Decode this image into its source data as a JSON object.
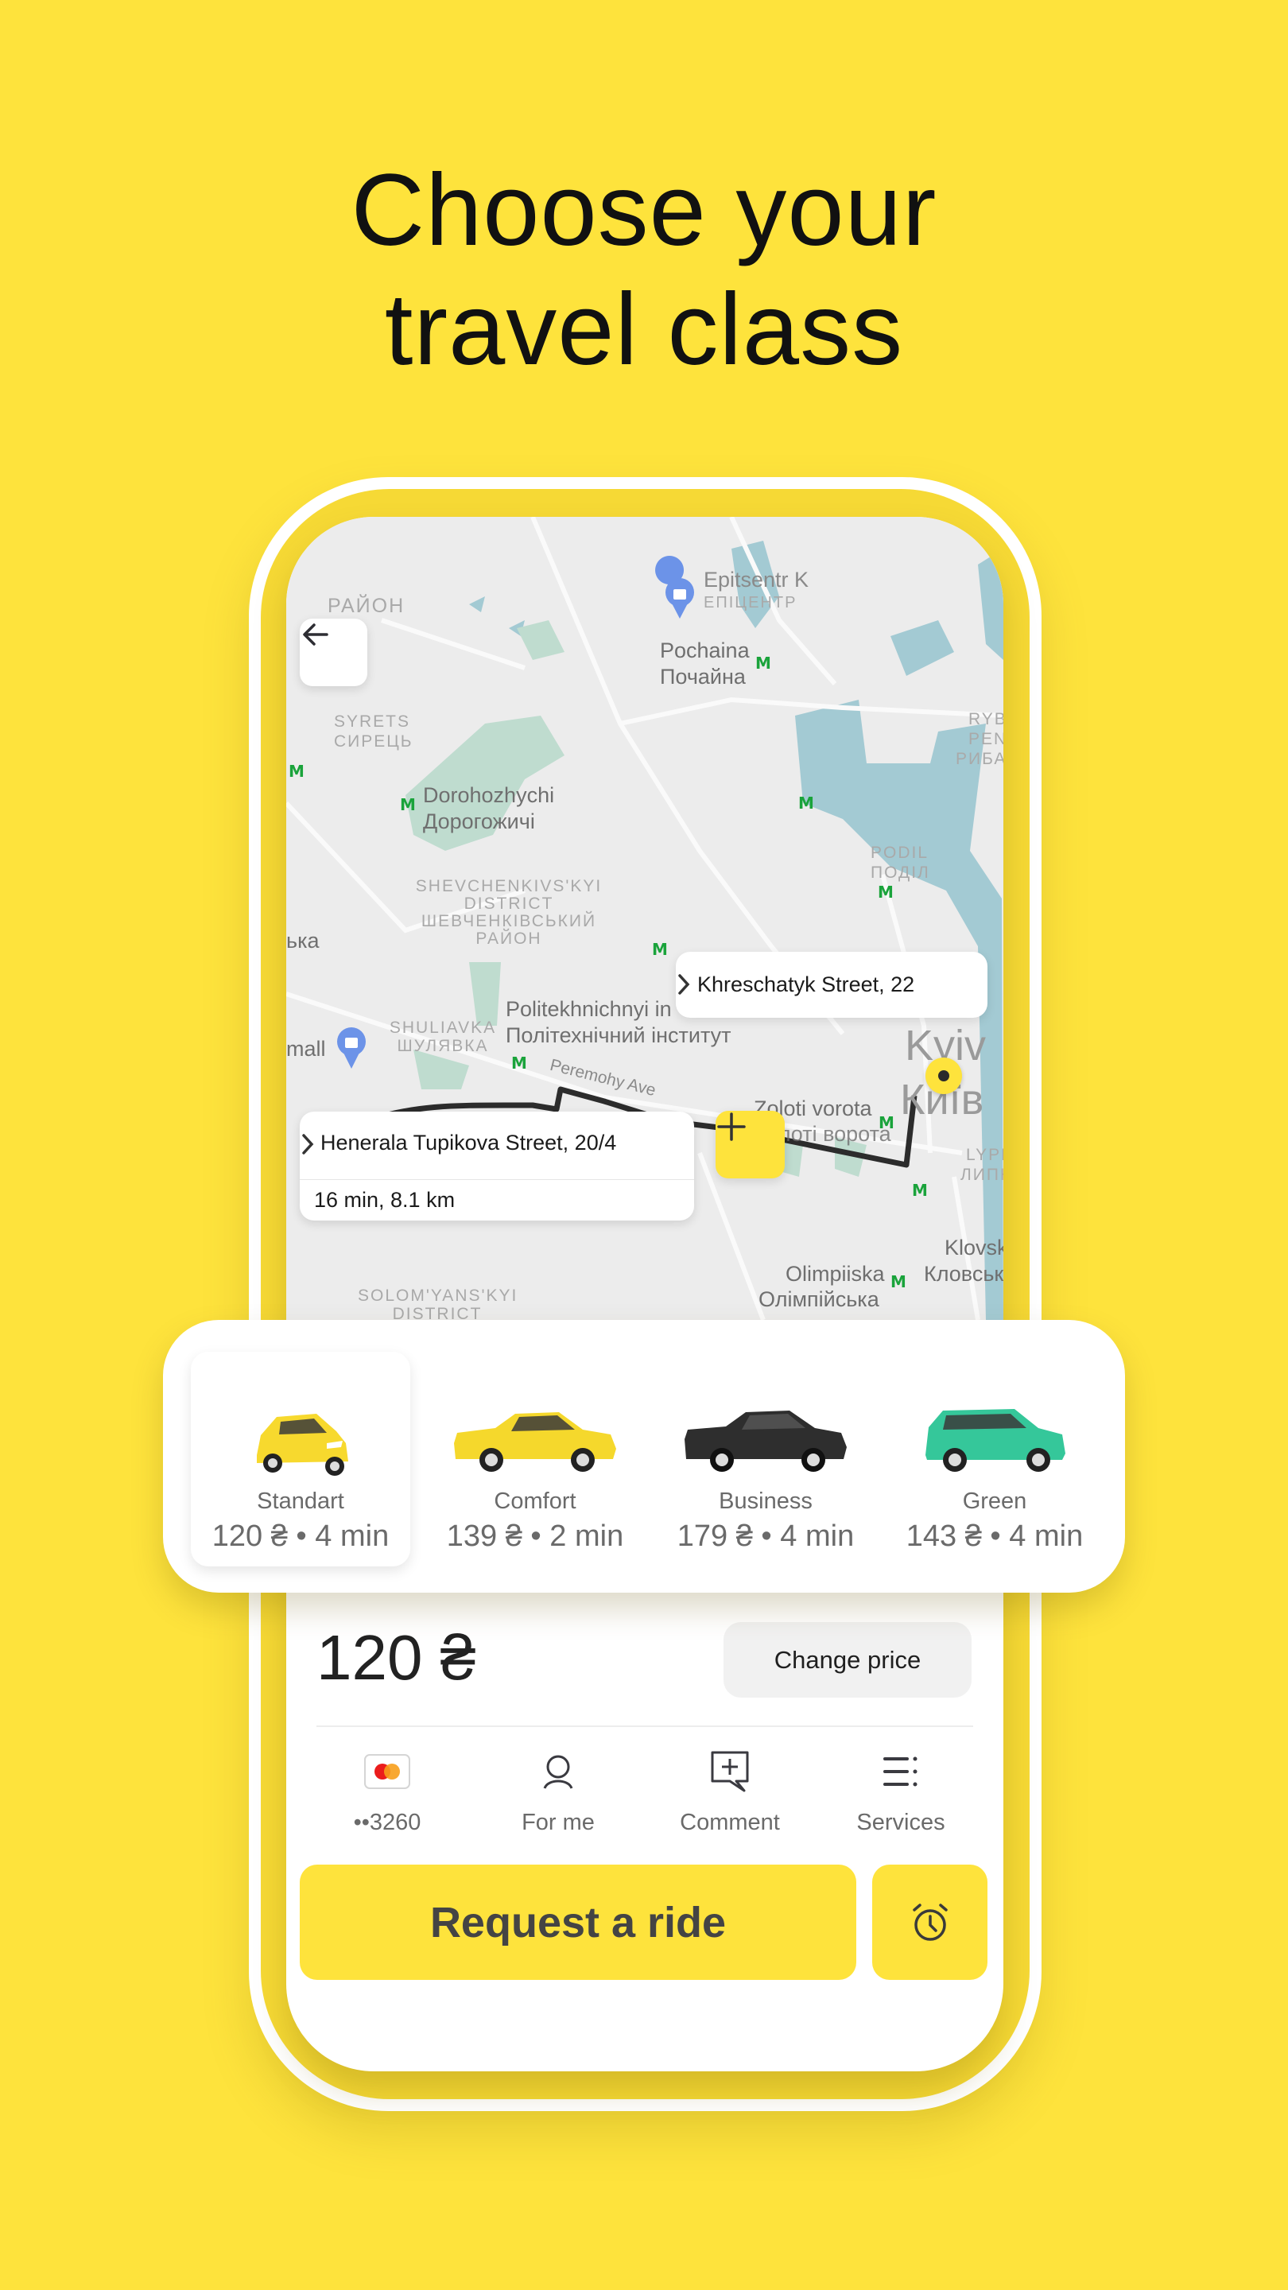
{
  "headline": {
    "line1": "Choose your",
    "line2": "travel class"
  },
  "map": {
    "labels": {
      "raion_top": "РАЙОН",
      "epitsentr_en": "Epitsentr K",
      "epitsentr_uk": "ЕПІЦЕНТР",
      "pochaina_en": "Pochaina",
      "pochaina_uk": "Почайна",
      "syrets_en": "SYRETS",
      "syrets_uk": "СИРЕЦЬ",
      "rybalskyi_en1": "RYB",
      "rybalskyi_en2": "PEN",
      "rybalskyi_uk": "РИБАЛ",
      "dorohozhychi_en": "Dorohozhychi",
      "dorohozhychi_uk": "Дорогожичі",
      "podil_en": "PODIL",
      "podil_uk": "ПОДІЛ",
      "shevchenkivskyi_en1": "SHEVCHENKIVS'KYI",
      "shevchenkivskyi_en2": "DISTRICT",
      "shevchenkivskyi_uk1": "ШЕВЧЕНКІВСЬКИЙ",
      "shevchenkivskyi_uk2": "РАЙОН",
      "ka_fragment": "ька",
      "mall_fragment": "mall",
      "shuliavka_en": "SHULIAVKA",
      "shuliavka_uk": "ШУЛЯВКА",
      "politekh_en": "Politekhnichnyi in",
      "politekh_uk": "Політехнічний інститут",
      "peremohy": "Peremohy Ave",
      "kyiv_en": "Kyiv",
      "kyiv_uk": "Київ",
      "zoloti_en": "Zoloti vorota",
      "zoloti_uk": "Золоті ворота",
      "lypky_en": "LYPK",
      "lypky_uk": "ЛИПК",
      "klovska_en": "Klovsk",
      "klovska_uk": "Кловськ",
      "olimpiiska_en": "Olimpiiska",
      "olimpiiska_uk": "Олімпійська",
      "solomianskyi_en1": "SOLOM'YANS'KYI",
      "solomianskyi_en2": "DISTRICT",
      "metro_glyph": "M"
    },
    "destination": {
      "address": "Khreschatyk Street, 22"
    },
    "origin": {
      "address": "Henerala Tupikova Street, 20/4",
      "eta": "16 min, 8.1 km"
    }
  },
  "classes": [
    {
      "name": "Standart",
      "meta": "120 ₴ • 4 min",
      "color": "#F7D92E",
      "selected": true
    },
    {
      "name": "Comfort",
      "meta": "139 ₴ • 2 min",
      "color": "#F5D82C",
      "selected": false
    },
    {
      "name": "Business",
      "meta": "179 ₴ • 4 min",
      "color": "#2E2E2E",
      "selected": false
    },
    {
      "name": "Green",
      "meta": "143 ₴ • 4 min",
      "color": "#35C79A",
      "selected": false
    }
  ],
  "order": {
    "price": "120 ₴",
    "change_price_label": "Change price",
    "options": [
      {
        "label": "••3260",
        "icon": "mastercard-icon"
      },
      {
        "label": "For me",
        "icon": "person-icon"
      },
      {
        "label": "Comment",
        "icon": "comment-add-icon"
      },
      {
        "label": "Services",
        "icon": "services-list-icon"
      }
    ],
    "request_label": "Request a ride"
  },
  "colors": {
    "brand_yellow": "#FEE33C",
    "metro_green": "#1AA33B",
    "water": "#A3CAD3",
    "park": "#BFDCCF"
  }
}
